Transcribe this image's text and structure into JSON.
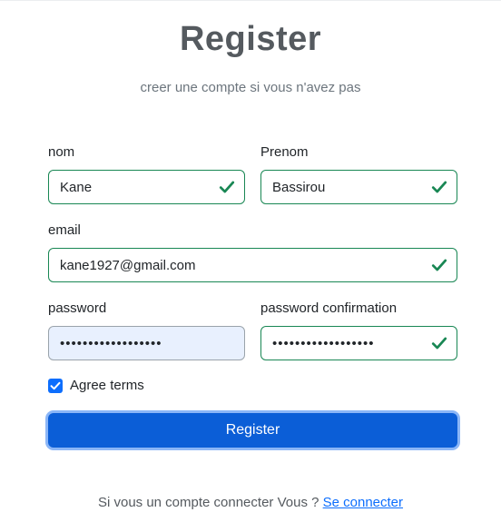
{
  "header": {
    "title": "Register",
    "subtitle": "creer une compte si vous n'avez pas"
  },
  "form": {
    "nom": {
      "label": "nom",
      "value": "Kane",
      "valid": true
    },
    "prenom": {
      "label": "Prenom",
      "value": "Bassirou",
      "valid": true
    },
    "email": {
      "label": "email",
      "value": "kane1927@gmail.com",
      "valid": true
    },
    "password": {
      "label": "password",
      "value": "Passwordkane123456",
      "autofilled": true
    },
    "password_confirmation": {
      "label": "password confirmation",
      "value": "Passwordkane123456",
      "valid": true
    },
    "terms": {
      "label": "Agree terms",
      "checked": true
    },
    "submit_label": "Register"
  },
  "footer": {
    "text": "Si vous un compte connecter Vous ? ",
    "link_label": "Se connecter"
  },
  "colors": {
    "valid": "#198754",
    "primary": "#0b5ed7",
    "autofill": "#e8f0fe"
  },
  "icons": {
    "valid": "check-icon",
    "checkbox": "checkbox-checked-icon"
  }
}
